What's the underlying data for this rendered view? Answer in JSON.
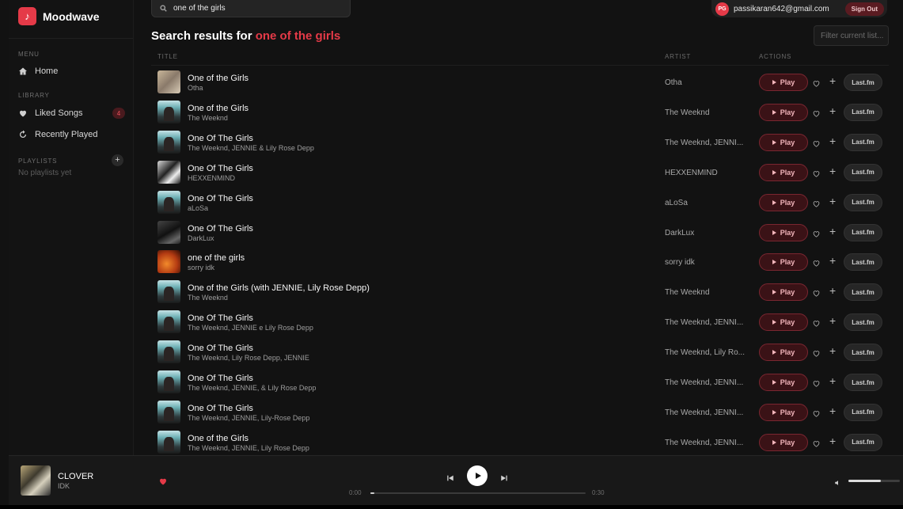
{
  "app": {
    "name": "Moodwave",
    "logo_glyph": "♪"
  },
  "search": {
    "value": "one of the girls"
  },
  "user": {
    "initials": "PG",
    "email": "passikaran642@gmail.com",
    "signout_label": "Sign Out"
  },
  "results": {
    "prefix": "Search results for ",
    "query": "one of the girls",
    "filter_placeholder": "Filter current list..."
  },
  "sidebar": {
    "menu_label": "MENU",
    "home_label": "Home",
    "library_label": "LIBRARY",
    "liked_label": "Liked Songs",
    "liked_count": "4",
    "recent_label": "Recently Played",
    "playlists_label": "PLAYLISTS",
    "add_glyph": "+",
    "empty_text": "No playlists yet"
  },
  "table": {
    "headers": {
      "title": "TITLE",
      "artist": "ARTIST",
      "actions": "ACTIONS"
    },
    "play_label": "Play",
    "plus_glyph": "+",
    "lastfm_label": "Last.fm",
    "rows": [
      {
        "title": "One of the Girls",
        "subtitle": "Otha",
        "artist": "Otha",
        "art": "t1"
      },
      {
        "title": "One of the Girls",
        "subtitle": "The Weeknd",
        "artist": "The Weeknd",
        "art": "tw"
      },
      {
        "title": "One Of The Girls",
        "subtitle": "The Weeknd, JENNIE & Lily Rose Depp",
        "artist": "The Weeknd, JENNI...",
        "art": "tw"
      },
      {
        "title": "One Of The Girls",
        "subtitle": "HEXXENMIND",
        "artist": "HEXXENMIND",
        "art": "hx"
      },
      {
        "title": "One Of The Girls",
        "subtitle": "aLoSa",
        "artist": "aLoSa",
        "art": "tw"
      },
      {
        "title": "One Of The Girls",
        "subtitle": "DarkLux",
        "artist": "DarkLux",
        "art": "dk"
      },
      {
        "title": "one of the girls",
        "subtitle": "sorry idk",
        "artist": "sorry idk",
        "art": "or"
      },
      {
        "title": "One of the Girls (with JENNIE, Lily Rose Depp)",
        "subtitle": "The Weeknd",
        "artist": "The Weeknd",
        "art": "tw"
      },
      {
        "title": "One Of The Girls",
        "subtitle": "The Weeknd, JENNIE e Lily Rose Depp",
        "artist": "The Weeknd, JENNI...",
        "art": "tw"
      },
      {
        "title": "One Of The Girls",
        "subtitle": "The Weeknd, Lily Rose Depp, JENNIE",
        "artist": "The Weeknd, Lily Ro...",
        "art": "tw"
      },
      {
        "title": "One Of The Girls",
        "subtitle": "The Weeknd, JENNIE, & Lily Rose Depp",
        "artist": "The Weeknd, JENNI...",
        "art": "tw"
      },
      {
        "title": "One Of The Girls",
        "subtitle": "The Weeknd, JENNIE, Lily-Rose Depp",
        "artist": "The Weeknd, JENNI...",
        "art": "tw"
      },
      {
        "title": "One of the Girls",
        "subtitle": "The Weeknd, JENNIE, Lily Rose Depp",
        "artist": "The Weeknd, JENNI...",
        "art": "tw"
      }
    ]
  },
  "player": {
    "track_title": "CLOVER",
    "track_artist": "IDK",
    "time_current": "0:00",
    "time_total": "0:30",
    "progress": 0.02,
    "volume": 0.63
  },
  "colors": {
    "accent": "#e53a48",
    "background": "#121212"
  }
}
